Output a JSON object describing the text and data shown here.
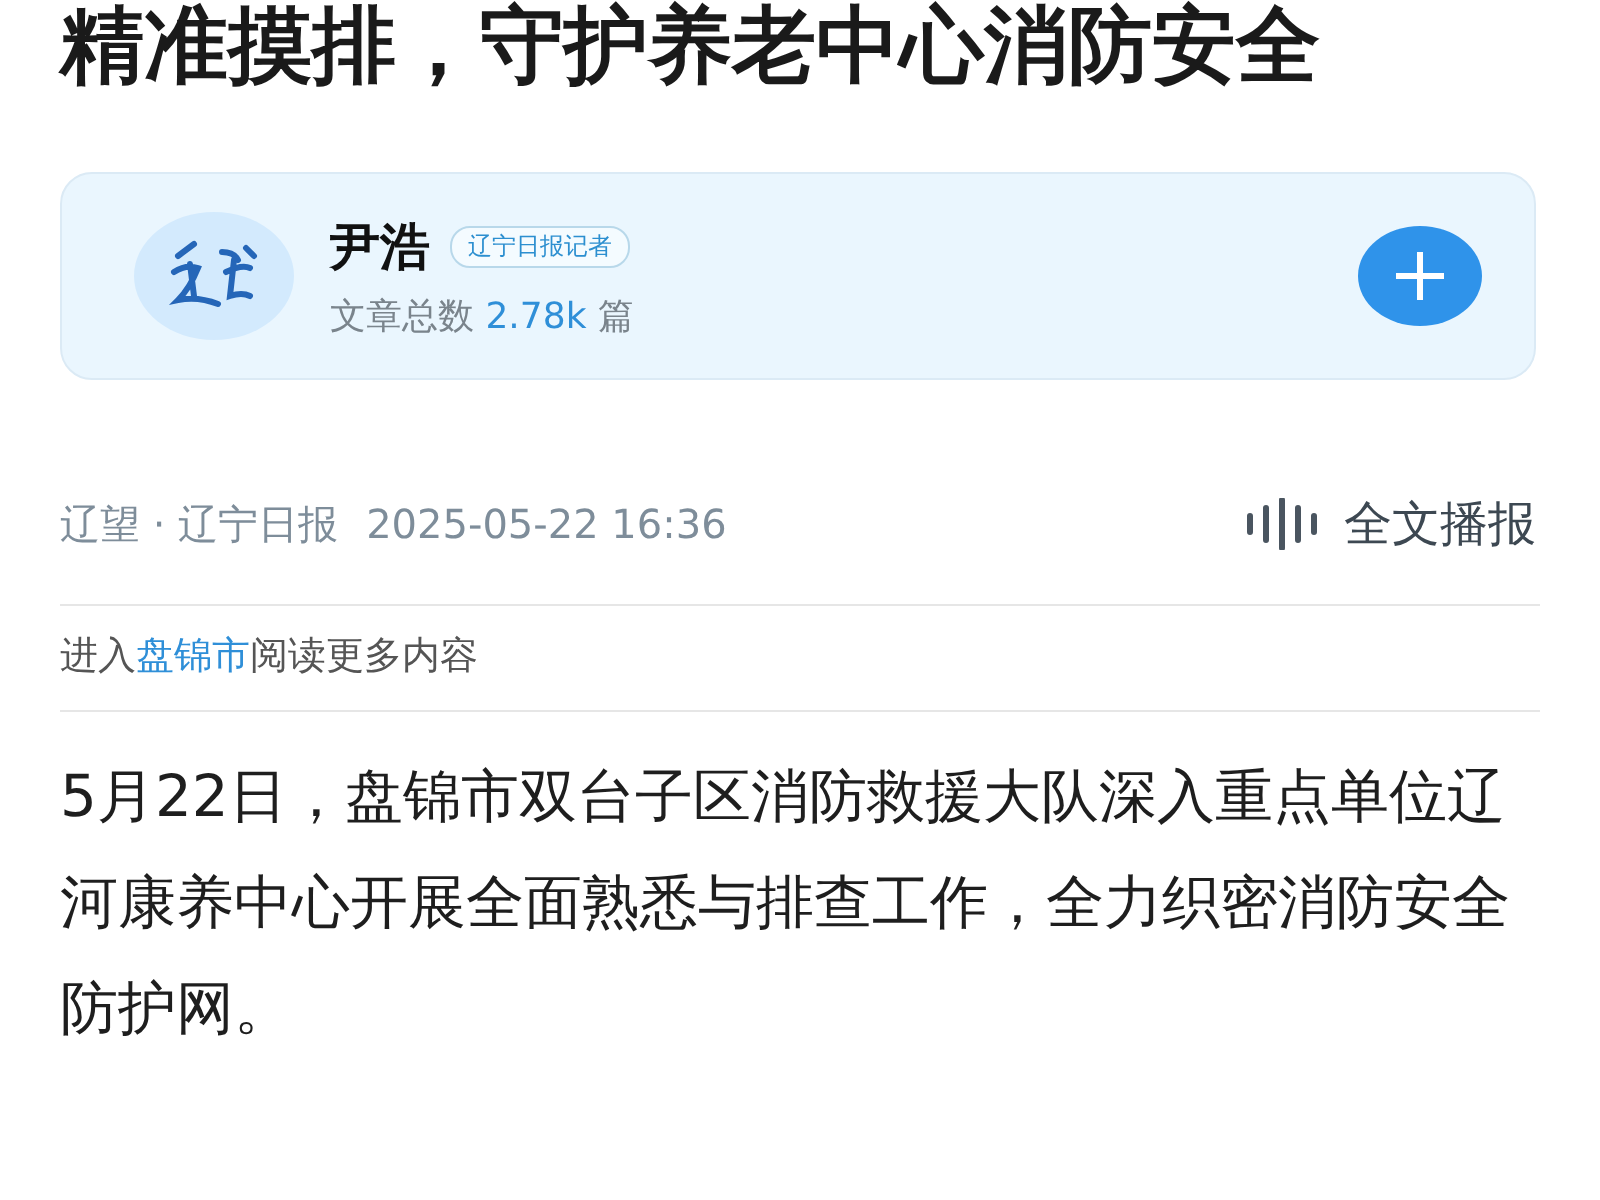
{
  "title": "精准摸排，守护养老中心消防安全",
  "author": {
    "name": "尹浩",
    "badge": "辽宁日报记者",
    "stats_label": "文章总数",
    "stats_count": "2.78k",
    "stats_unit": "篇"
  },
  "meta": {
    "source": "辽望 · 辽宁日报",
    "time": "2025-05-22 16:36",
    "listen": "全文播报"
  },
  "intro": {
    "prefix": "进入",
    "link": "盘锦市",
    "suffix": "阅读更多内容"
  },
  "body": "5月22日，盘锦市双台子区消防救援大队深入重点单位辽河康养中心开展全面熟悉与排查工作，全力织密消防安全防护网。"
}
